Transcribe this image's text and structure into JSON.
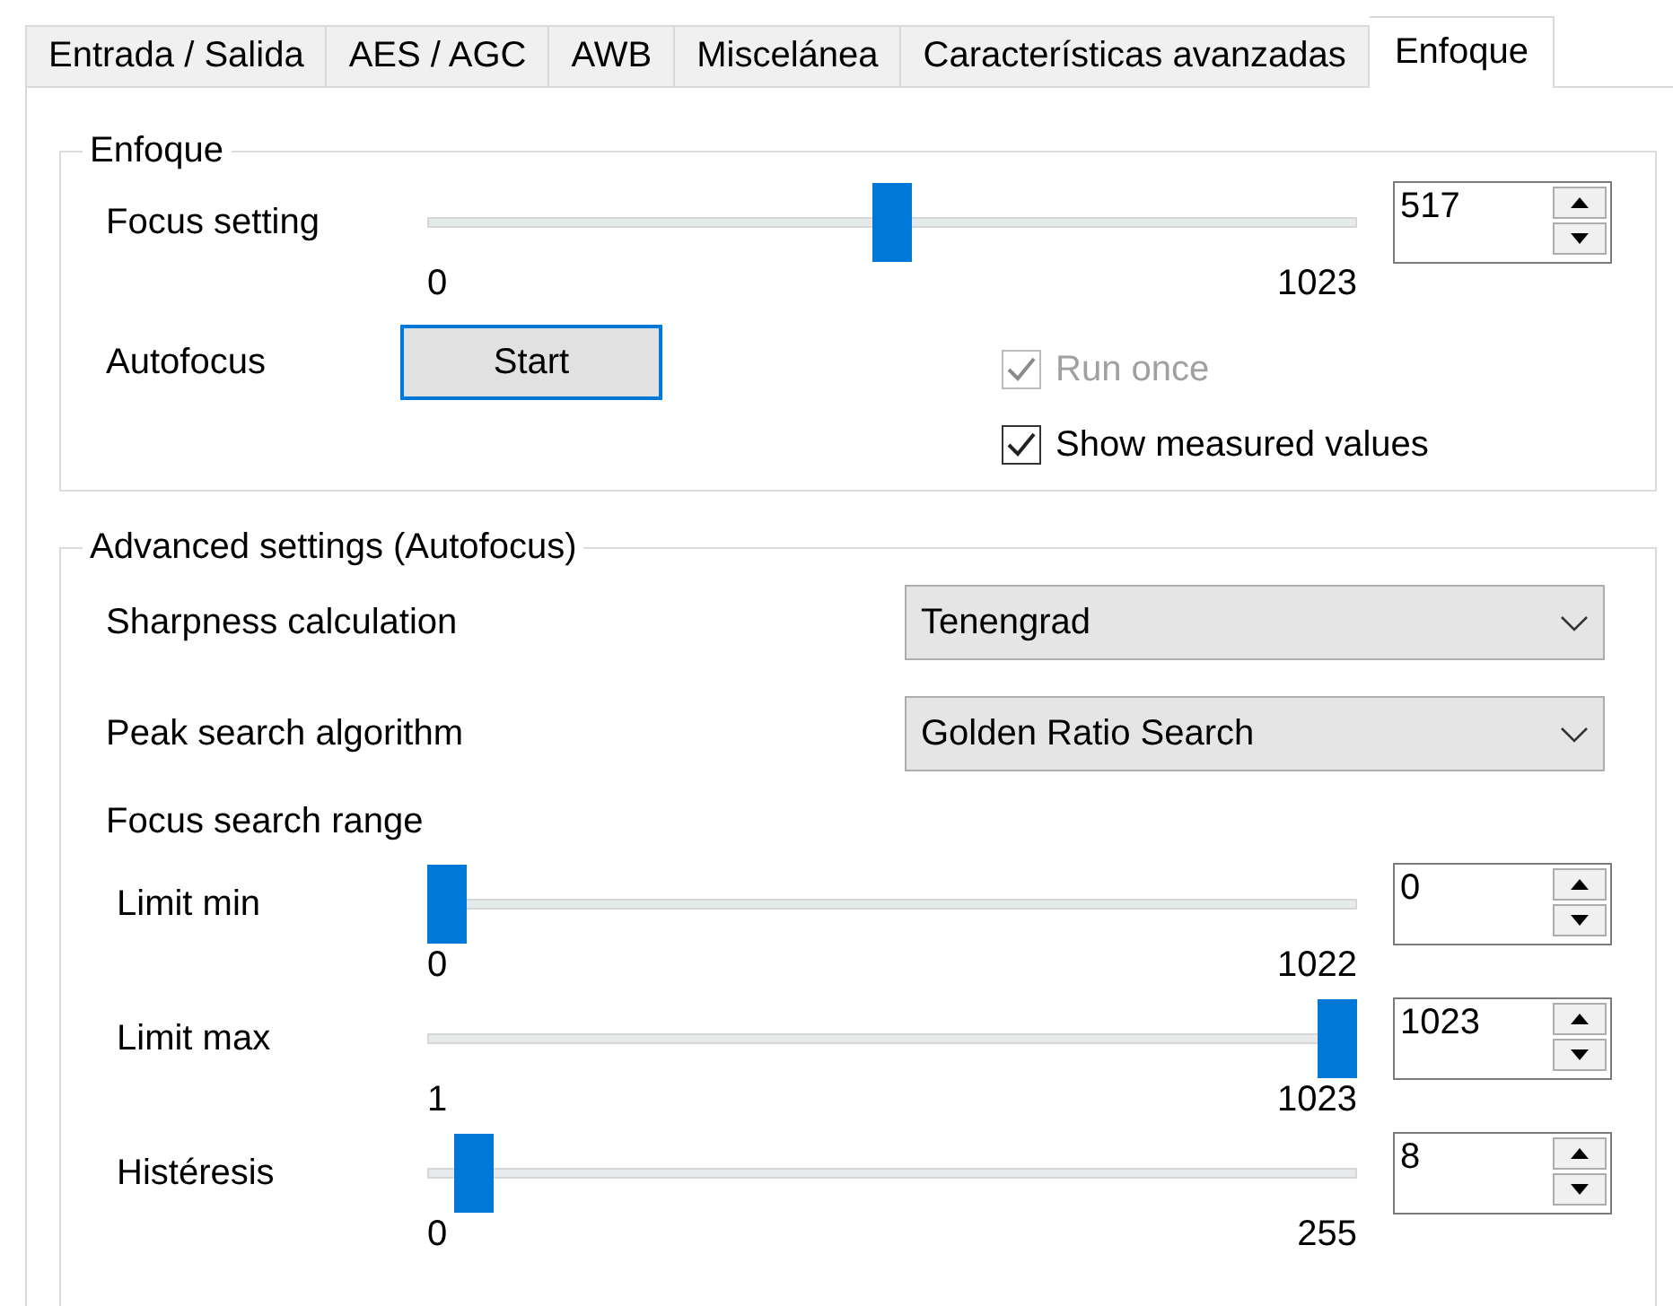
{
  "tabs": [
    {
      "label": "Entrada / Salida",
      "selected": false
    },
    {
      "label": "AES / AGC",
      "selected": false
    },
    {
      "label": "AWB",
      "selected": false
    },
    {
      "label": "Miscelánea",
      "selected": false
    },
    {
      "label": "Características avanzadas",
      "selected": false
    },
    {
      "label": "Enfoque",
      "selected": true
    }
  ],
  "focus_group": {
    "title": "Enfoque",
    "slider": {
      "label": "Focus setting",
      "level": 0.5,
      "min": "0",
      "max": "1023",
      "value": "517"
    },
    "autofocus_label": "Autofocus",
    "start_button": "Start",
    "checkboxes": [
      {
        "label": "Run once",
        "checked": true,
        "disabled": true
      },
      {
        "label": "Show measured values",
        "checked": true,
        "disabled": false
      }
    ]
  },
  "advanced_group": {
    "title": "Advanced settings (Autofocus)",
    "dropdowns": [
      {
        "label": "Sharpness calculation",
        "value": "Tenengrad"
      },
      {
        "label": "Peak search algorithm",
        "value": "Golden Ratio Search"
      }
    ],
    "range_label": "Focus search range",
    "sliders": [
      {
        "label": "Limit min",
        "level": 0,
        "min": "0",
        "max": "1022",
        "value": "0"
      },
      {
        "label": "Limit max",
        "level": 1,
        "min": "1",
        "max": "1023",
        "value": "1023"
      },
      {
        "label": "Histéresis",
        "level": 0.03,
        "min": "0",
        "max": "255",
        "value": "8"
      }
    ]
  }
}
